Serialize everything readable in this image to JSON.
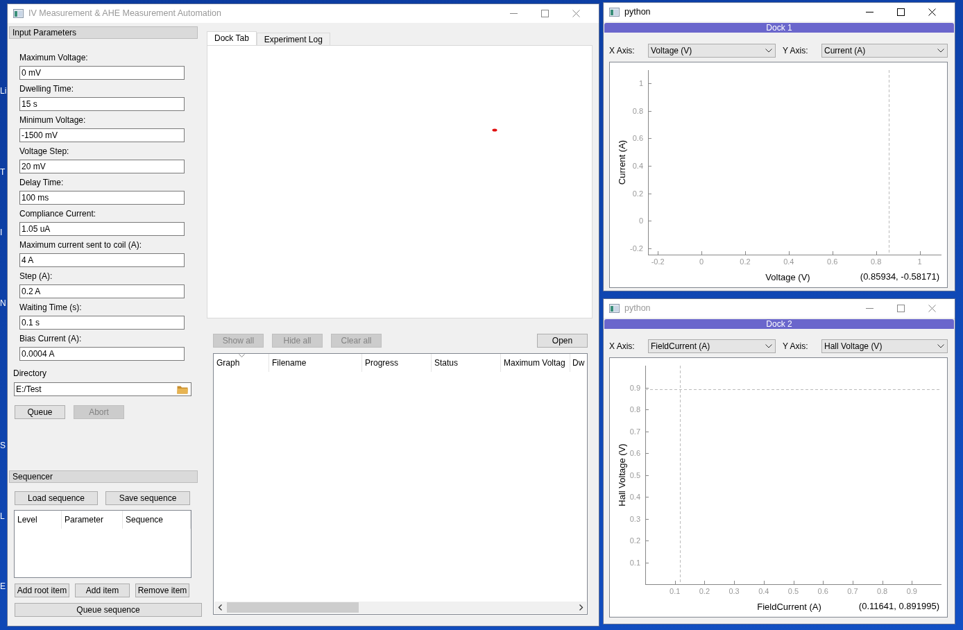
{
  "desktop": {
    "icon_labels": [
      "Li",
      "T",
      "I",
      "N",
      "S",
      "L",
      "E"
    ]
  },
  "main_window": {
    "title": "IV Measurement & AHE Measurement Automation",
    "active": false,
    "input_parameters": {
      "title": "Input Parameters",
      "fields": [
        {
          "label": "Maximum Voltage:",
          "value": "0 mV"
        },
        {
          "label": "Dwelling Time:",
          "value": "15 s"
        },
        {
          "label": "Minimum Voltage:",
          "value": "-1500 mV"
        },
        {
          "label": "Voltage Step:",
          "value": "20 mV"
        },
        {
          "label": "Delay Time:",
          "value": "100 ms"
        },
        {
          "label": "Compliance Current:",
          "value": "1.05 uA"
        },
        {
          "label": "Maximum current sent to coil (A):",
          "value": "4 A"
        },
        {
          "label": "Step (A):",
          "value": "0.2 A"
        },
        {
          "label": "Waiting Time (s):",
          "value": "0.1 s"
        },
        {
          "label": "Bias Current (A):",
          "value": "0.0004 A"
        }
      ]
    },
    "directory": {
      "label": "Directory",
      "value": "E:/Test"
    },
    "run_buttons": [
      {
        "label": "Queue",
        "disabled": false
      },
      {
        "label": "Abort",
        "disabled": true
      }
    ],
    "sequencer": {
      "title": "Sequencer",
      "file_buttons": [
        {
          "label": "Load sequence",
          "disabled": false
        },
        {
          "label": "Save sequence",
          "disabled": false
        }
      ],
      "columns": [
        "Level",
        "Parameter",
        "Sequence"
      ],
      "item_buttons": [
        {
          "label": "Add root item",
          "disabled": false
        },
        {
          "label": "Add item",
          "disabled": false
        },
        {
          "label": "Remove item",
          "disabled": false
        }
      ],
      "queue_button": {
        "label": "Queue sequence",
        "disabled": false
      }
    },
    "tabs": [
      {
        "label": "Dock Tab",
        "selected": true
      },
      {
        "label": "Experiment Log",
        "selected": false
      }
    ],
    "result_buttons": [
      {
        "label": "Show all",
        "disabled": true
      },
      {
        "label": "Hide all",
        "disabled": true
      },
      {
        "label": "Clear all",
        "disabled": true
      }
    ],
    "open_button": {
      "label": "Open",
      "disabled": false
    },
    "results_table": {
      "columns": [
        "Graph",
        "Filename",
        "Progress",
        "Status",
        "Maximum Voltag",
        "Dw"
      ]
    }
  },
  "docks": [
    {
      "window_title": "python",
      "active": true,
      "dock_title": "Dock 1",
      "x_axis": {
        "label": "X Axis:",
        "value": "Voltage (V)"
      },
      "y_axis": {
        "label": "Y Axis:",
        "value": "Current (A)"
      },
      "cursor_readout": "(0.85934, -0.58171)",
      "chart_data": {
        "type": "scatter",
        "xlabel": "Voltage (V)",
        "ylabel": "Current (A)",
        "xlim": [
          -0.245,
          1.1
        ],
        "ylim": [
          -0.245,
          1.096
        ],
        "xticks": [
          -0.2,
          0,
          0.2,
          0.4,
          0.6,
          0.8,
          1
        ],
        "yticks": [
          -0.2,
          0,
          0.2,
          0.4,
          0.6,
          0.8,
          1
        ],
        "ref_lines": [
          {
            "axis": "x",
            "value": 0.85934
          }
        ]
      }
    },
    {
      "window_title": "python",
      "active": false,
      "dock_title": "Dock 2",
      "x_axis": {
        "label": "X Axis:",
        "value": "FieldCurrent (A)"
      },
      "y_axis": {
        "label": "Y Axis:",
        "value": "Hall Voltage (V)"
      },
      "cursor_readout": "(0.11641, 0.891995)",
      "chart_data": {
        "type": "scatter",
        "xlabel": "FieldCurrent (A)",
        "ylabel": "Hall Voltage (V)",
        "xlim": [
          0,
          1
        ],
        "ylim": [
          0,
          1
        ],
        "xticks": [
          0.1,
          0.2,
          0.3,
          0.4,
          0.5,
          0.6,
          0.7,
          0.8,
          0.9
        ],
        "yticks": [
          0.1,
          0.2,
          0.3,
          0.4,
          0.5,
          0.6,
          0.7,
          0.8,
          0.9
        ],
        "ref_lines": [
          {
            "axis": "x",
            "value": 0.11641
          },
          {
            "axis": "y",
            "value": 0.891995
          }
        ]
      }
    }
  ]
}
